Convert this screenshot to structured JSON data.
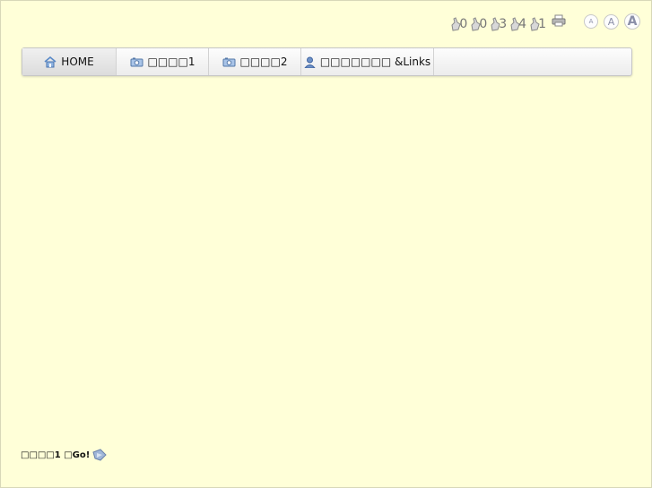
{
  "counters": [
    {
      "value": "0"
    },
    {
      "value": "0"
    },
    {
      "value": "3"
    },
    {
      "value": "4"
    },
    {
      "value": "1"
    }
  ],
  "font_size": {
    "small": "A",
    "medium": "A",
    "large": "A"
  },
  "nav": {
    "items": [
      {
        "label": "HOME",
        "icon": "home-icon"
      },
      {
        "label": "□□□□1",
        "icon": "camera-icon"
      },
      {
        "label": "□□□□2",
        "icon": "camera-icon"
      },
      {
        "label": "□□□□□□□ &Links",
        "icon": "user-icon"
      }
    ]
  },
  "footer": {
    "text": "□□□□1 □Go!"
  },
  "colors": {
    "background": "#ffffd8",
    "accent": "#5a8ac8"
  }
}
